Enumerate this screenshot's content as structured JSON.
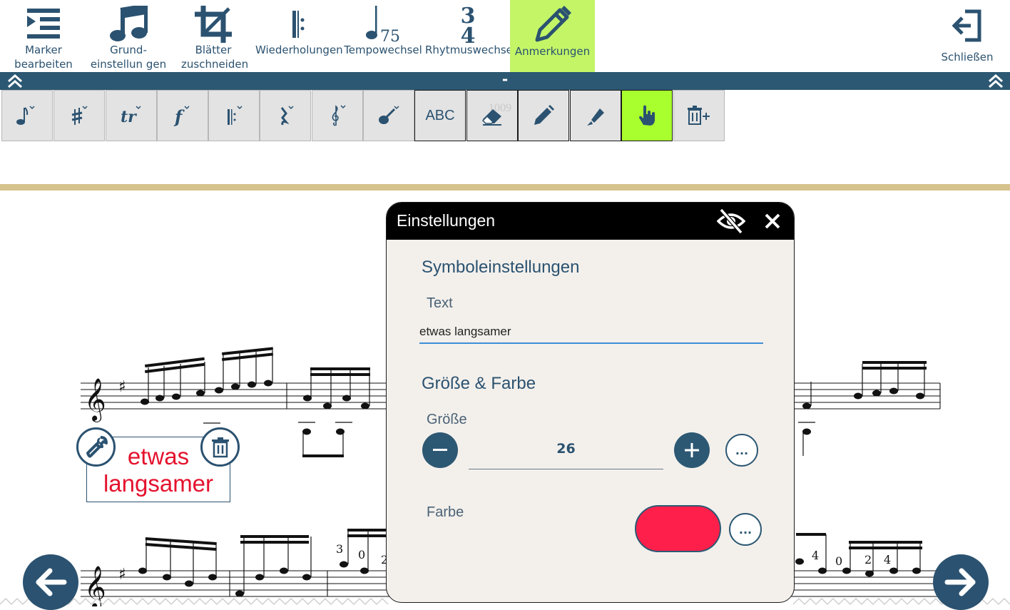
{
  "toolbar": {
    "items": [
      {
        "label": "Marker bearbeiten",
        "icon": "indent-list-icon"
      },
      {
        "label": "Grund-einstellun gen",
        "icon": "music-note-icon"
      },
      {
        "label": "Blätter zuschneiden",
        "icon": "crop-icon"
      },
      {
        "label": "Wiederholungen",
        "icon": "repeat-sign-icon"
      },
      {
        "label": "Tempowechsel",
        "icon": "tempo-note-icon",
        "tempo": "75"
      },
      {
        "label": "Rhytmuswechsel",
        "icon": "time-signature-icon",
        "top": "3",
        "bottom": "4"
      },
      {
        "label": "Anmerkungen",
        "icon": "pencil-icon",
        "active": true
      }
    ],
    "close_label": "Schließen",
    "strip_mid": "-"
  },
  "tools": [
    {
      "name": "note-tool",
      "icon": "eighth-note-icon"
    },
    {
      "name": "accidental-tool",
      "icon": "sharp-icon"
    },
    {
      "name": "ornament-tool",
      "icon": "trill-icon"
    },
    {
      "name": "dynamics-tool",
      "icon": "forte-icon"
    },
    {
      "name": "repeat-tool",
      "icon": "repeat-bar-icon"
    },
    {
      "name": "rest-tool",
      "icon": "rest-icon"
    },
    {
      "name": "clef-tool",
      "icon": "treble-clef-icon"
    },
    {
      "name": "guitar-tool",
      "icon": "guitar-icon"
    },
    {
      "name": "text-tool",
      "icon": "abc-text-icon",
      "label": "ABC"
    },
    {
      "name": "eraser-tool",
      "icon": "eraser-icon"
    },
    {
      "name": "pencil-tool",
      "icon": "pencil-icon"
    },
    {
      "name": "highlighter-tool",
      "icon": "highlighter-icon"
    },
    {
      "name": "pointer-tool",
      "icon": "hand-pointer-icon",
      "active": true
    },
    {
      "name": "delete-all-tool",
      "icon": "trash-plus-icon"
    }
  ],
  "annotation": {
    "line1": "etwas",
    "line2": "langsamer"
  },
  "dialog": {
    "title": "Einstellungen",
    "symbol_section": "Symboleinstellungen",
    "text_label": "Text",
    "text_value": "etwas langsamer",
    "size_section": "Größe & Farbe",
    "size_label": "Größe",
    "size_value": "26",
    "color_label": "Farbe",
    "more_label": "...",
    "swatch_color": "#ff1f4b"
  },
  "score_numbers": {
    "fingering_a": "3",
    "fingering_b": "0",
    "fingering_c": "2",
    "fingering_d": "4",
    "fingering_e": "0",
    "fingering_f": "2",
    "fingering_g": "4",
    "faded_bar_number": "1009"
  }
}
